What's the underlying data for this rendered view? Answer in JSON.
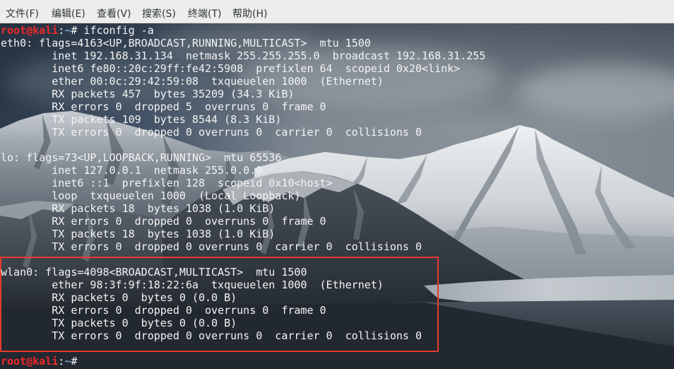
{
  "menu": {
    "items": [
      "文件(F)",
      "编辑(E)",
      "查看(V)",
      "搜索(S)",
      "终端(T)",
      "帮助(H)"
    ]
  },
  "terminal": {
    "command_prompt": {
      "user_host": "root@kali",
      "separator": ":",
      "path": "~",
      "symbol": "#",
      "command": "ifconfig -a"
    },
    "interfaces": [
      {
        "header": "eth0: flags=4163<UP,BROADCAST,RUNNING,MULTICAST>  mtu 1500",
        "details": [
          "inet 192.168.31.134  netmask 255.255.255.0  broadcast 192.168.31.255",
          "inet6 fe80::20c:29ff:fe42:5908  prefixlen 64  scopeid 0x20<link>",
          "ether 00:0c:29:42:59:08  txqueuelen 1000  (Ethernet)",
          "RX packets 457  bytes 35209 (34.3 KiB)",
          "RX errors 0  dropped 5  overruns 0  frame 0",
          "TX packets 109  bytes 8544 (8.3 KiB)",
          "TX errors 0  dropped 0 overruns 0  carrier 0  collisions 0"
        ]
      },
      {
        "header": "lo: flags=73<UP,LOOPBACK,RUNNING>  mtu 65536",
        "details": [
          "inet 127.0.0.1  netmask 255.0.0.0",
          "inet6 ::1  prefixlen 128  scopeid 0x10<host>",
          "loop  txqueuelen 1000  (Local Loopback)",
          "RX packets 18  bytes 1038 (1.0 KiB)",
          "RX errors 0  dropped 0  overruns 0  frame 0",
          "TX packets 18  bytes 1038 (1.0 KiB)",
          "TX errors 0  dropped 0 overruns 0  carrier 0  collisions 0"
        ]
      },
      {
        "header": "wlan0: flags=4098<BROADCAST,MULTICAST>  mtu 1500",
        "details": [
          "ether 98:3f:9f:18:22:6a  txqueuelen 1000  (Ethernet)",
          "RX packets 0  bytes 0 (0.0 B)",
          "RX errors 0  dropped 0  overruns 0  frame 0",
          "TX packets 0  bytes 0 (0.0 B)",
          "TX errors 0  dropped 0 overruns 0  carrier 0  collisions 0"
        ]
      }
    ],
    "current_prompt": {
      "user_host": "root@kali",
      "separator": ":",
      "path": "~",
      "symbol": "#"
    }
  },
  "colors": {
    "menu_background": "#ededed",
    "menu_text": "#2e3436",
    "terminal_foreground": "#f4f4f4",
    "prompt_user": "#ef2929",
    "prompt_path": "#729fcf",
    "highlight_border": "#e53b30"
  }
}
